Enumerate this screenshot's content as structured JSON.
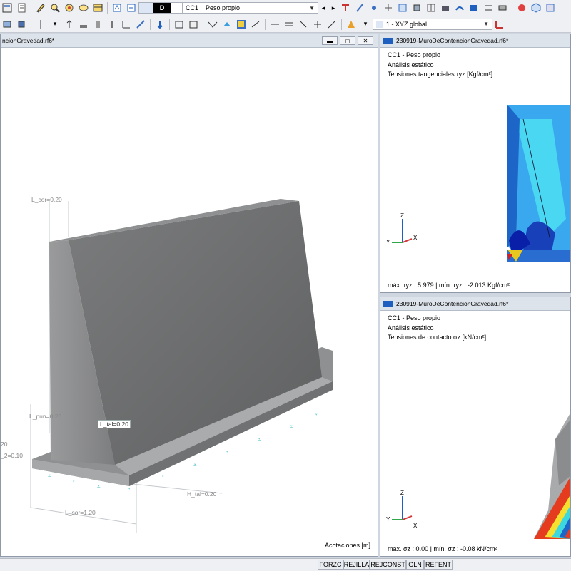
{
  "toolbar": {
    "load_case_code": "D",
    "load_case_id": "CC1",
    "load_case_name": "Peso propio",
    "coord_system": "1 - XYZ global"
  },
  "main_view": {
    "title": "ncionGravedad.rf6*",
    "units_label": "Acotaciones [m]",
    "dimensions": {
      "l_cor_top": "L_cor=0.20",
      "l_pun": "L_pun=0.20",
      "l_tal": "L_tal=0.20",
      "h_tal": "H_tal=0.20",
      "l_sor": "L_sor=1.20",
      "left_value_1": "20",
      "left_value_2": "_2=0.10"
    }
  },
  "view_top": {
    "title": "230919-MuroDeContencionGravedad.rf6*",
    "line1": "CC1 - Peso propio",
    "line2": "Análisis estático",
    "line3": "Tensiones tangenciales τyz [Kgf/cm²]",
    "summary": "máx. τyz : 5.979 | mín. τyz : -2.013 Kgf/cm²"
  },
  "view_bottom": {
    "title": "230919-MuroDeContencionGravedad.rf6*",
    "line1": "CC1 - Peso propio",
    "line2": "Análisis estático",
    "line3": "Tensiones de contacto σz [kN/cm²]",
    "summary": "máx. σz : 0.00 | mín. σz : -0.08 kN/cm²"
  },
  "axes": {
    "x": "X",
    "y": "Y",
    "z": "Z"
  },
  "status_bar": [
    "FORZC",
    "REJILLA",
    "REJCONST",
    "GLN",
    "REFENT"
  ],
  "colors": {
    "accent": "#1f5fbf",
    "background": "#cfd6e0",
    "concrete": "#8a8c8d"
  }
}
